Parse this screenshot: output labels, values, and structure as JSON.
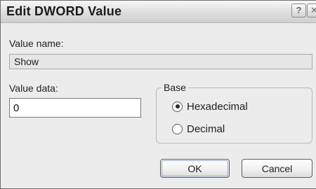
{
  "window": {
    "title": "Edit DWORD Value",
    "help_glyph": "?",
    "close_glyph": "✕"
  },
  "value_name": {
    "label": "Value name:",
    "value": "Show"
  },
  "value_data": {
    "label": "Value data:",
    "value": "0"
  },
  "base": {
    "legend": "Base",
    "options": [
      {
        "label": "Hexadecimal",
        "selected": true
      },
      {
        "label": "Decimal",
        "selected": false
      }
    ]
  },
  "buttons": {
    "ok": "OK",
    "cancel": "Cancel"
  }
}
